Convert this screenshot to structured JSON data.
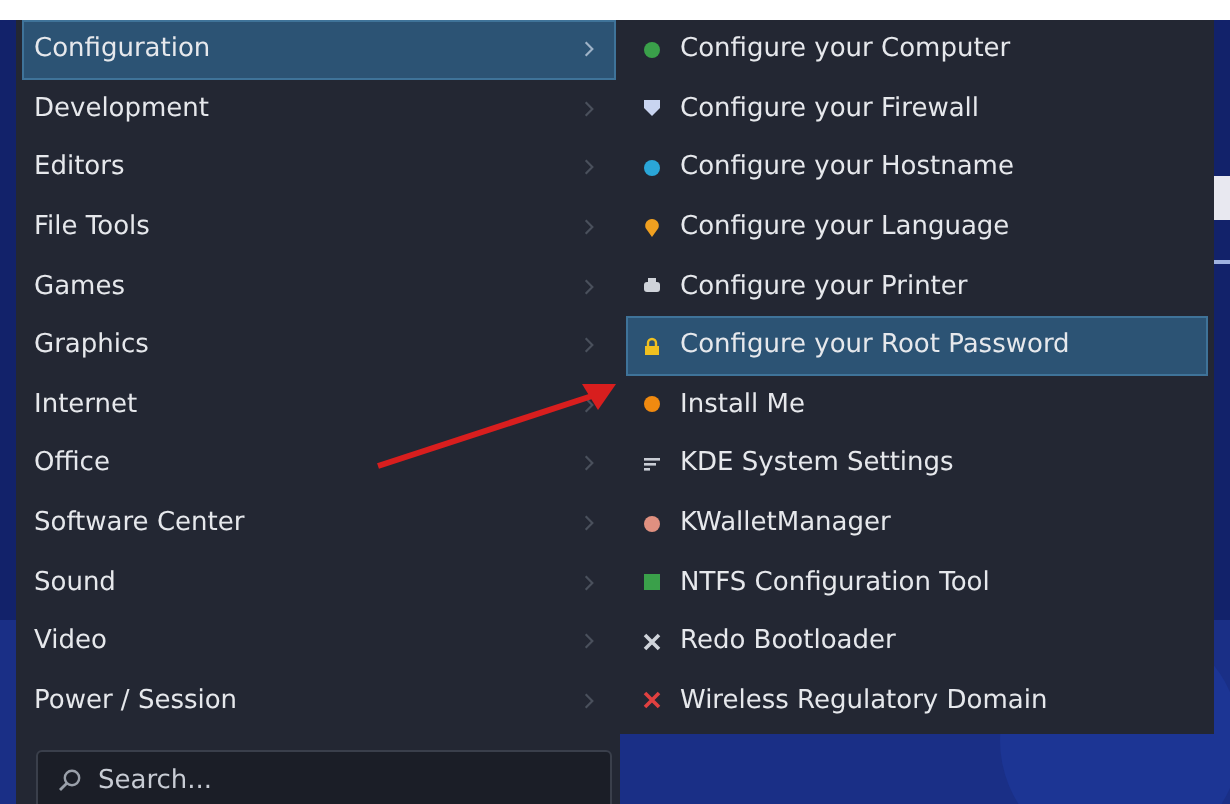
{
  "menu": {
    "categories": [
      {
        "label": "Configuration",
        "selected": true
      },
      {
        "label": "Development",
        "selected": false
      },
      {
        "label": "Editors",
        "selected": false
      },
      {
        "label": "File Tools",
        "selected": false
      },
      {
        "label": "Games",
        "selected": false
      },
      {
        "label": "Graphics",
        "selected": false
      },
      {
        "label": "Internet",
        "selected": false
      },
      {
        "label": "Office",
        "selected": false
      },
      {
        "label": "Software Center",
        "selected": false
      },
      {
        "label": "Sound",
        "selected": false
      },
      {
        "label": "Video",
        "selected": false
      },
      {
        "label": "Power / Session",
        "selected": false
      }
    ]
  },
  "submenu": {
    "items": [
      {
        "label": "Configure your Computer",
        "selected": false
      },
      {
        "label": "Configure your Firewall",
        "selected": false
      },
      {
        "label": "Configure your Hostname",
        "selected": false
      },
      {
        "label": "Configure your Language",
        "selected": false
      },
      {
        "label": "Configure your Printer",
        "selected": false
      },
      {
        "label": "Configure your Root Password",
        "selected": true
      },
      {
        "label": "Install Me",
        "selected": false
      },
      {
        "label": "KDE System Settings",
        "selected": false
      },
      {
        "label": "KWalletManager",
        "selected": false
      },
      {
        "label": "NTFS Configuration Tool",
        "selected": false
      },
      {
        "label": "Redo Bootloader",
        "selected": false
      },
      {
        "label": "Wireless Regulatory Domain",
        "selected": false
      }
    ]
  },
  "search": {
    "placeholder": "Search..."
  }
}
